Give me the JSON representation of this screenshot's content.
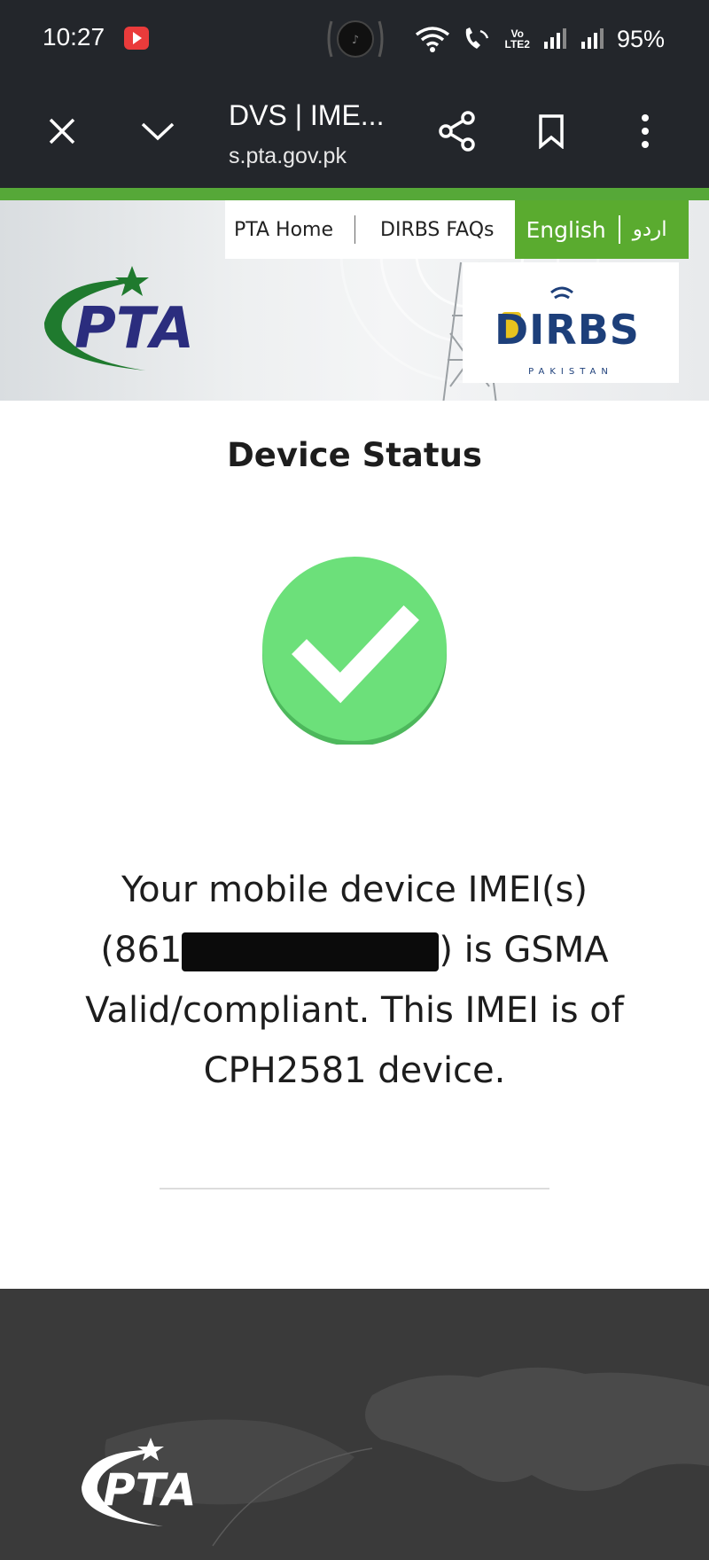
{
  "status_bar": {
    "time": "10:27",
    "volte_top": "Vo",
    "volte_bottom": "LTE2",
    "battery": "95%"
  },
  "browser": {
    "title": "DVS | IME...",
    "url": "s.pta.gov.pk"
  },
  "site_nav": {
    "items": [
      {
        "label": "PTA Home"
      },
      {
        "label": "DIRBS FAQs"
      }
    ],
    "lang_english": "English",
    "lang_urdu": "اردو"
  },
  "logos": {
    "pta_text": "PTA",
    "dirbs_text": "DIRBS",
    "dirbs_sub": "PAKISTAN"
  },
  "main": {
    "title": "Device Status",
    "status_icon": "check-circle-icon",
    "message_line1": "Your mobile device IMEI(s)",
    "imei_prefix": "(861",
    "imei_suffix": ") is GSMA",
    "message_line3": "Valid/compliant. This IMEI is of",
    "message_line4": "CPH2581 device."
  },
  "colors": {
    "brand_green": "#56a838",
    "pta_navy": "#2b2d7e",
    "check_green": "#6ce07a",
    "footer_bg": "#3a3a3a"
  }
}
